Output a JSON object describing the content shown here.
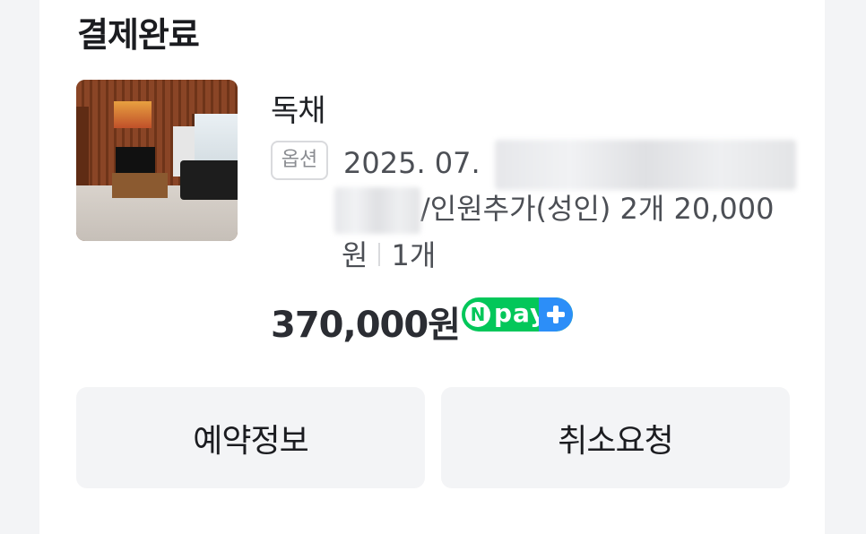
{
  "order": {
    "status": "결제완료",
    "product_name": "독채",
    "option_badge": "옵션",
    "option": {
      "line1_prefix": "2025. 07.",
      "line2_suffix": "/인원추가(성인) 2개 20,000",
      "line3_unit": "원",
      "quantity": "1개"
    },
    "price": "370,000원",
    "payment_badge": {
      "n": "N",
      "text": "pay",
      "brand_color": "#03c75a",
      "plus_color": "#2c8ef8"
    }
  },
  "actions": {
    "reservation_info": "예약정보",
    "cancel_request": "취소요청"
  }
}
